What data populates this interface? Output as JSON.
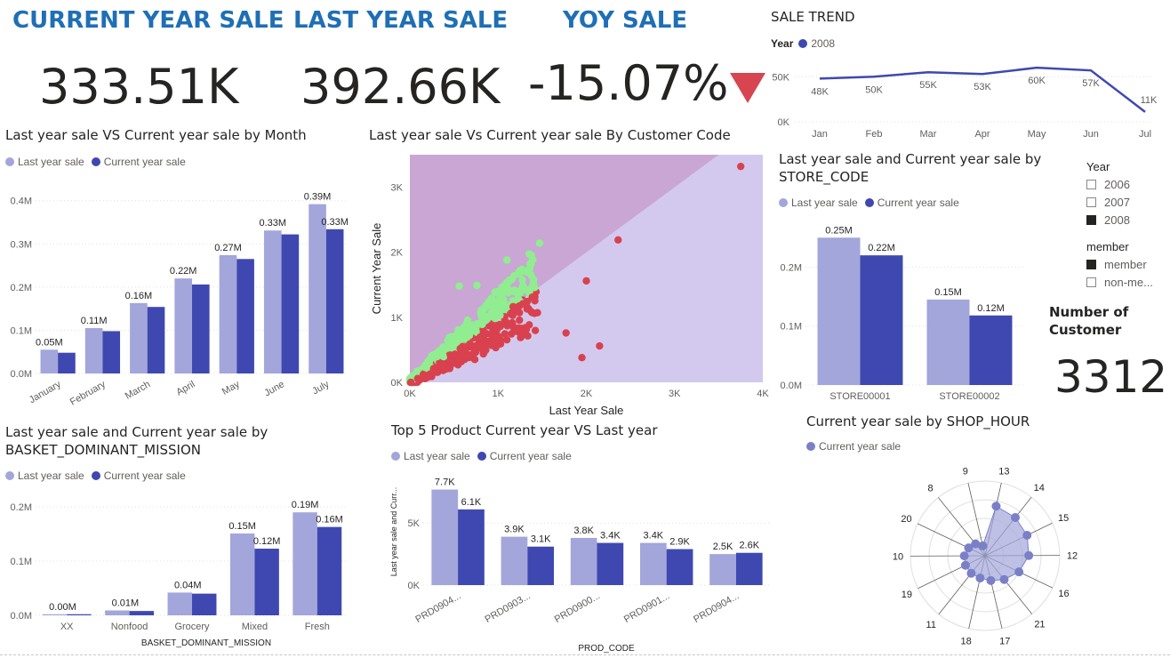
{
  "kpis": {
    "current": {
      "title": "CURRENT YEAR SALE",
      "value": "333.51K"
    },
    "last": {
      "title": "LAST YEAR SALE",
      "value": "392.66K"
    },
    "yoy": {
      "title": "YOY SALE",
      "value": "-15.07%",
      "indicator": "down-triangle-icon",
      "indicator_color": "#d64550"
    }
  },
  "colors": {
    "last_year": "#a3a6da",
    "current_year": "#3f48b0",
    "green_points": "#90ee90",
    "red_points": "#d9414e",
    "scatter_upper": "#c9a6d4",
    "scatter_lower": "#d3c9ef"
  },
  "trend": {
    "title": "SALE TREND",
    "legend_title": "Year",
    "legend_item": "2008",
    "chart_data": {
      "type": "line",
      "categories": [
        "Jan",
        "Feb",
        "Mar",
        "Apr",
        "May",
        "Jun",
        "Jul"
      ],
      "values": [
        48,
        50,
        55,
        53,
        60,
        57,
        11
      ],
      "labels": [
        "48K",
        "50K",
        "55K",
        "53K",
        "60K",
        "57K",
        "11K"
      ],
      "yticks": [
        "0K",
        "50K"
      ],
      "ylim": [
        0,
        70
      ]
    }
  },
  "monthly": {
    "title": "Last year sale VS Current year sale by Month",
    "legend": [
      "Last year sale",
      "Current year sale"
    ],
    "chart_data": {
      "type": "bar",
      "categories": [
        "January",
        "February",
        "March",
        "April",
        "May",
        "June",
        "July"
      ],
      "series": [
        {
          "name": "Last year sale",
          "values": [
            0.055,
            0.105,
            0.163,
            0.22,
            0.274,
            0.331,
            0.392
          ]
        },
        {
          "name": "Current year sale",
          "values": [
            0.048,
            0.098,
            0.154,
            0.206,
            0.265,
            0.322,
            0.334
          ]
        }
      ],
      "labels": [
        "0.05M",
        "0.11M",
        "0.16M",
        "0.22M",
        "0.27M",
        "0.33M",
        "0.39M",
        "0.33M"
      ],
      "yticks": [
        "0.0M",
        "0.1M",
        "0.2M",
        "0.3M",
        "0.4M"
      ],
      "ylim": [
        0,
        0.42
      ]
    }
  },
  "basket": {
    "title": "Last year sale and Current year sale by BASKET_DOMINANT_MISSION",
    "legend": [
      "Last year sale",
      "Current year sale"
    ],
    "xlabel": "BASKET_DOMINANT_MISSION",
    "chart_data": {
      "type": "bar",
      "categories": [
        "XX",
        "Nonfood",
        "Grocery",
        "Mixed",
        "Fresh"
      ],
      "series": [
        {
          "name": "Last year sale",
          "values": [
            0.002,
            0.009,
            0.042,
            0.151,
            0.19
          ]
        },
        {
          "name": "Current year sale",
          "values": [
            0.002,
            0.008,
            0.04,
            0.123,
            0.163
          ]
        }
      ],
      "labels": [
        "0.00M",
        "0.01M",
        "0.04M",
        "0.15M",
        "0.12M",
        "0.19M",
        "0.16M"
      ],
      "yticks": [
        "0.0M",
        "0.1M",
        "0.2M"
      ],
      "ylim": [
        0,
        0.21
      ]
    }
  },
  "scatter": {
    "title": "Last year sale Vs Current year sale By Customer Code",
    "xlabel": "Last Year Sale",
    "ylabel": "Current Year Sale",
    "chart_data": {
      "type": "scatter",
      "xlim": [
        0,
        4000
      ],
      "ylim": [
        0,
        3500
      ],
      "xticks": [
        "0K",
        "1K",
        "2K",
        "3K",
        "4K"
      ],
      "yticks": [
        "0K",
        "1K",
        "2K",
        "3K"
      ],
      "notable_points": [
        {
          "x": 3750,
          "y": 3320,
          "group": "red"
        },
        {
          "x": 2360,
          "y": 2190,
          "group": "red"
        },
        {
          "x": 2000,
          "y": 1560,
          "group": "red"
        },
        {
          "x": 1470,
          "y": 2140,
          "group": "green"
        },
        {
          "x": 1100,
          "y": 1880,
          "group": "green"
        },
        {
          "x": 1770,
          "y": 760,
          "group": "red"
        },
        {
          "x": 2150,
          "y": 560,
          "group": "red"
        },
        {
          "x": 1950,
          "y": 380,
          "group": "red"
        },
        {
          "x": 560,
          "y": 1480,
          "group": "green"
        },
        {
          "x": 760,
          "y": 1490,
          "group": "green"
        }
      ]
    }
  },
  "store": {
    "title": "Last year sale and Current year sale by STORE_CODE",
    "legend": [
      "Last year sale",
      "Current year sale"
    ],
    "chart_data": {
      "type": "bar",
      "categories": [
        "STORE00001",
        "STORE00002"
      ],
      "series": [
        {
          "name": "Last year sale",
          "values": [
            0.25,
            0.145
          ]
        },
        {
          "name": "Current year sale",
          "values": [
            0.22,
            0.118
          ]
        }
      ],
      "labels": [
        "0.25M",
        "0.22M",
        "0.15M",
        "0.12M"
      ],
      "yticks": [
        "0.0M",
        "0.1M",
        "0.2M"
      ],
      "ylim": [
        0,
        0.27
      ]
    }
  },
  "slicer_year": {
    "title": "Year",
    "items": [
      {
        "label": "2006",
        "checked": false
      },
      {
        "label": "2007",
        "checked": false
      },
      {
        "label": "2008",
        "checked": true
      }
    ]
  },
  "slicer_member": {
    "title": "member",
    "items": [
      {
        "label": "member",
        "checked": true
      },
      {
        "label": "non-me...",
        "checked": false
      }
    ]
  },
  "customers": {
    "title": "Number of Customer",
    "value": "3312"
  },
  "products": {
    "title": "Top 5 Product Current year VS Last year",
    "legend": [
      "Last year sale",
      "Current year sale"
    ],
    "ylabel": "Last year sale and Curr...",
    "xlabel": "PROD_CODE",
    "chart_data": {
      "type": "bar",
      "categories": [
        "PRD0904...",
        "PRD0903...",
        "PRD0900...",
        "PRD0901...",
        "PRD0904..."
      ],
      "series": [
        {
          "name": "Last year sale",
          "values": [
            7.7,
            3.9,
            3.8,
            3.4,
            2.5
          ]
        },
        {
          "name": "Current year sale",
          "values": [
            6.1,
            3.1,
            3.4,
            2.9,
            2.6
          ]
        }
      ],
      "labels": [
        "7.7K",
        "6.1K",
        "3.9K",
        "3.1K",
        "3.8K",
        "3.4K",
        "3.4K",
        "2.9K",
        "2.5K",
        "2.6K"
      ],
      "yticks": [
        "0K",
        "5K"
      ],
      "ylim": [
        0,
        8.6
      ]
    }
  },
  "shop_hour": {
    "title": "Current year sale by SHOP_HOUR",
    "legend": [
      "Current year sale"
    ],
    "chart_data": {
      "type": "radar",
      "categories": [
        "13",
        "14",
        "15",
        "12",
        "16",
        "21",
        "17",
        "18",
        "11",
        "19",
        "10",
        "20",
        "8",
        "9"
      ],
      "values": [
        1.0,
        0.96,
        0.92,
        0.86,
        0.74,
        0.6,
        0.5,
        0.45,
        0.44,
        0.43,
        0.41,
        0.36,
        0.3,
        0.2
      ]
    }
  }
}
